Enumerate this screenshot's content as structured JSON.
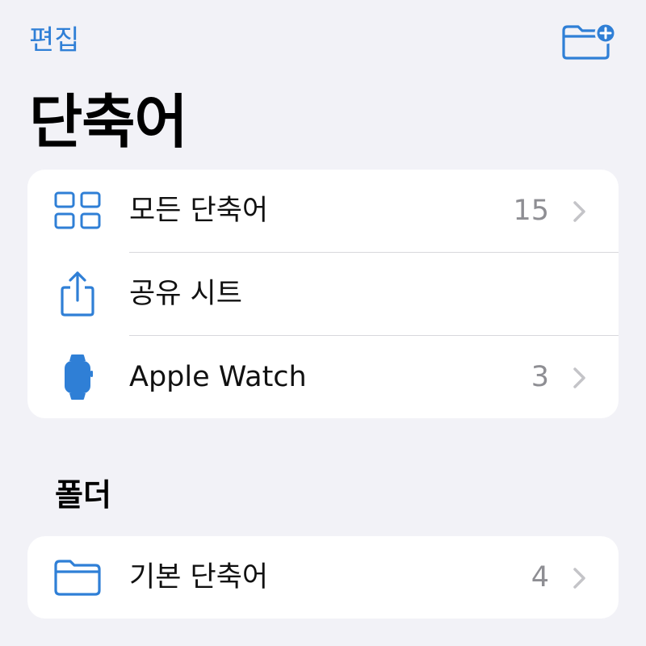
{
  "nav": {
    "edit_label": "편집",
    "new_folder_icon": "folder-plus-icon"
  },
  "title": "단축어",
  "main_list": [
    {
      "icon": "grid-icon",
      "label": "모든 단축어",
      "count": "15",
      "has_chevron": true
    },
    {
      "icon": "share-icon",
      "label": "공유 시트",
      "count": "",
      "has_chevron": false
    },
    {
      "icon": "watch-icon",
      "label": "Apple Watch",
      "count": "3",
      "has_chevron": true
    }
  ],
  "folders": {
    "header": "폴더",
    "items": [
      {
        "icon": "folder-icon",
        "label": "기본 단축어",
        "count": "4",
        "has_chevron": true
      }
    ]
  },
  "colors": {
    "accent": "#2f7fd6",
    "background": "#f2f2f7",
    "card": "#ffffff",
    "secondary_text": "#8e8e93",
    "chevron": "#c4c4c8"
  }
}
